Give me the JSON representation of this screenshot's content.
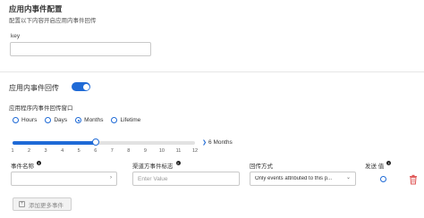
{
  "header": {
    "title": "应用内事件配置",
    "subtitle": "配置以下内容开启应用内事件回传"
  },
  "key_field": {
    "label": "key",
    "value": ""
  },
  "callback": {
    "label": "应用内事件回传",
    "enabled": true
  },
  "window": {
    "label": "应用程序内事件回传窗口",
    "options": [
      "Hours",
      "Days",
      "Months",
      "Lifetime"
    ],
    "selected": "Months"
  },
  "slider": {
    "ticks": [
      "1",
      "2",
      "3",
      "4",
      "5",
      "6",
      "7",
      "8",
      "9",
      "10",
      "11",
      "12"
    ],
    "min": 1,
    "max": 12,
    "value": 6,
    "value_label": "6 Months"
  },
  "table": {
    "columns": {
      "event_name": "事件名称",
      "channel_event": "渠道方事件标志",
      "method": "回传方式",
      "send_value": "发送 值"
    },
    "row": {
      "event_name_value": "",
      "channel_event_placeholder": "Enter Value",
      "method_value": "Only events attributed to this p..."
    }
  },
  "add_button": {
    "label": "添加更多事件"
  },
  "colors": {
    "accent": "#1f6ad6",
    "danger": "#e05a5a"
  }
}
